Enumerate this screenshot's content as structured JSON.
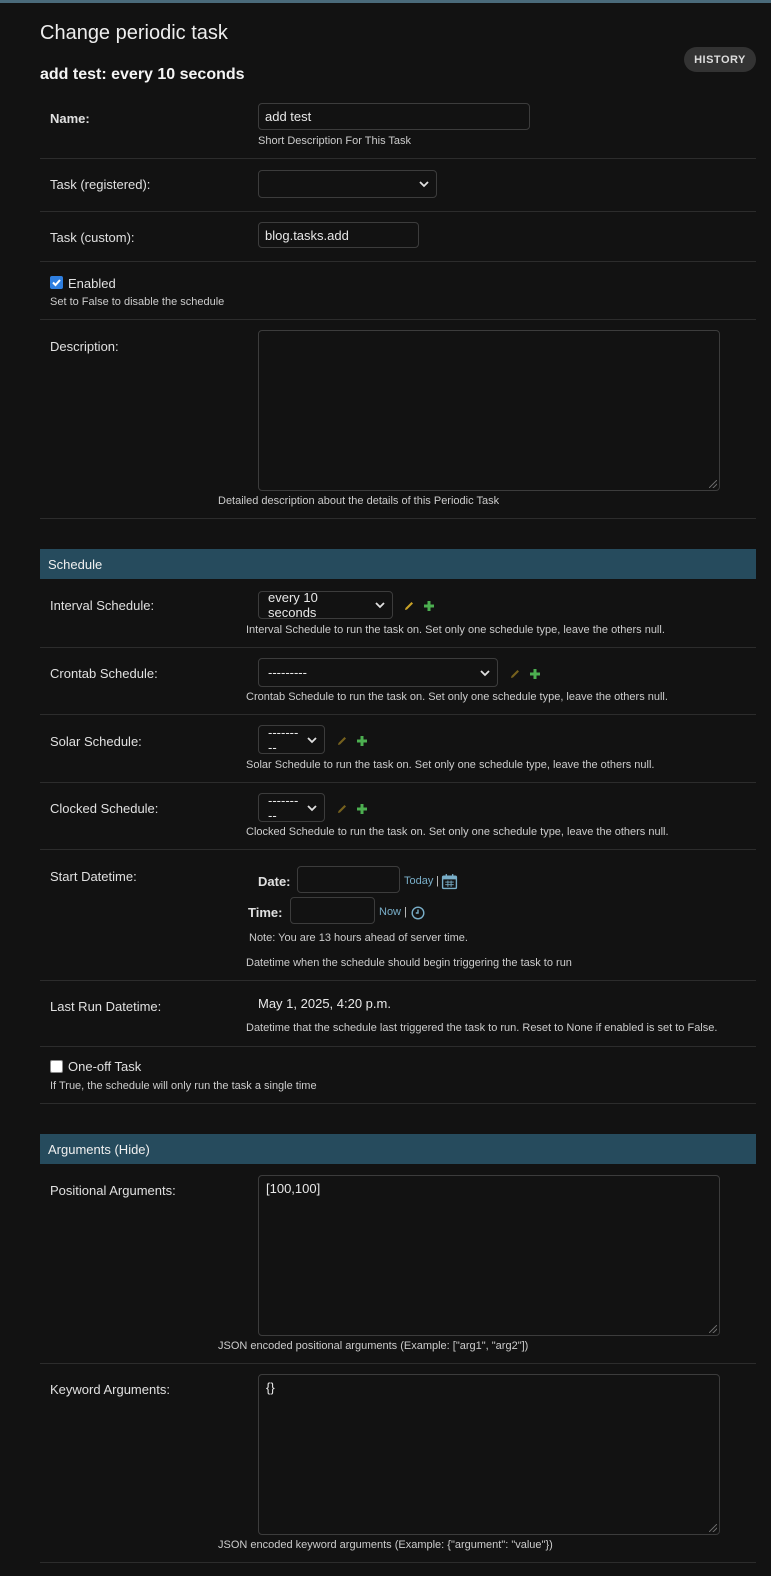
{
  "page_title": "Change periodic task",
  "object_title": "add test: every 10 seconds",
  "history_label": "HISTORY",
  "fields": {
    "name": {
      "label": "Name:",
      "value": "add test",
      "help": "Short Description For This Task"
    },
    "task_registered": {
      "label": "Task (registered):",
      "value": ""
    },
    "task_custom": {
      "label": "Task (custom):",
      "value": "blog.tasks.add"
    },
    "enabled": {
      "label": "Enabled",
      "checked": true,
      "help": "Set to False to disable the schedule"
    },
    "description": {
      "label": "Description:",
      "value": "",
      "help": "Detailed description about the details of this Periodic Task"
    }
  },
  "schedule": {
    "heading": "Schedule",
    "interval": {
      "label": "Interval Schedule:",
      "value": "every 10 seconds",
      "help": "Interval Schedule to run the task on. Set only one schedule type, leave the others null."
    },
    "crontab": {
      "label": "Crontab Schedule:",
      "value": "---------",
      "help": "Crontab Schedule to run the task on. Set only one schedule type, leave the others null."
    },
    "solar": {
      "label": "Solar Schedule:",
      "value": "---------",
      "help": "Solar Schedule to run the task on. Set only one schedule type, leave the others null."
    },
    "clocked": {
      "label": "Clocked Schedule:",
      "value": "---------",
      "help": "Clocked Schedule to run the task on. Set only one schedule type, leave the others null."
    },
    "start": {
      "label": "Start Datetime:",
      "date_label": "Date:",
      "date_value": "",
      "today_link": "Today",
      "sep": "|",
      "time_label": "Time:",
      "time_value": "",
      "now_link": "Now",
      "note": "Note: You are 13 hours ahead of server time.",
      "help": "Datetime when the schedule should begin triggering the task to run"
    },
    "last_run": {
      "label": "Last Run Datetime:",
      "value": "May 1, 2025, 4:20 p.m.",
      "help": "Datetime that the schedule last triggered the task to run. Reset to None if enabled is set to False."
    },
    "one_off": {
      "label": "One-off Task",
      "checked": false,
      "help": "If True, the schedule will only run the task a single time"
    }
  },
  "arguments": {
    "heading": "Arguments (Hide)",
    "positional": {
      "label": "Positional Arguments:",
      "value": "[100,100]",
      "help": "JSON encoded positional arguments (Example: [\"arg1\", \"arg2\"])"
    },
    "keyword": {
      "label": "Keyword Arguments:",
      "value": "{}",
      "help": "JSON encoded keyword arguments (Example: {\"argument\": \"value\"})"
    }
  },
  "colors": {
    "background": "#121212",
    "section_header": "#264b5d",
    "link": "#79aec8",
    "edit_icon": "#c9a227",
    "add_icon": "#4caf50"
  }
}
